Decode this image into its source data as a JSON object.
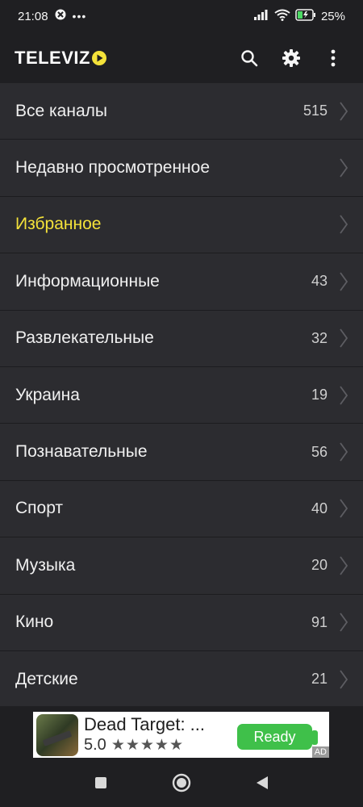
{
  "status_bar": {
    "time": "21:08",
    "dots": "•••",
    "battery_percent": "25%"
  },
  "app_bar": {
    "logo_text": "TELEVIZ",
    "icons": [
      "search-icon",
      "gear-icon",
      "more-vert-icon"
    ]
  },
  "list": {
    "items": [
      {
        "label": "Все каналы",
        "count": "515"
      },
      {
        "label": "Недавно просмотренное",
        "count": ""
      },
      {
        "label": "Избранное",
        "count": "",
        "highlight": true
      },
      {
        "label": "Информационные",
        "count": "43"
      },
      {
        "label": "Развлекательные",
        "count": "32"
      },
      {
        "label": "Украина",
        "count": "19"
      },
      {
        "label": "Познавательные",
        "count": "56"
      },
      {
        "label": "Спорт",
        "count": "40"
      },
      {
        "label": "Музыка",
        "count": "20"
      },
      {
        "label": "Кино",
        "count": "91"
      },
      {
        "label": "Детские",
        "count": "21"
      }
    ]
  },
  "ad": {
    "title": "Dead Target: ...",
    "rating": "5.0",
    "stars": "★★★★★",
    "button": "Ready",
    "badge": "AD"
  },
  "colors": {
    "accent": "#f4e23a",
    "row_bg": "#2c2c30",
    "app_bg": "#1f1f22"
  }
}
